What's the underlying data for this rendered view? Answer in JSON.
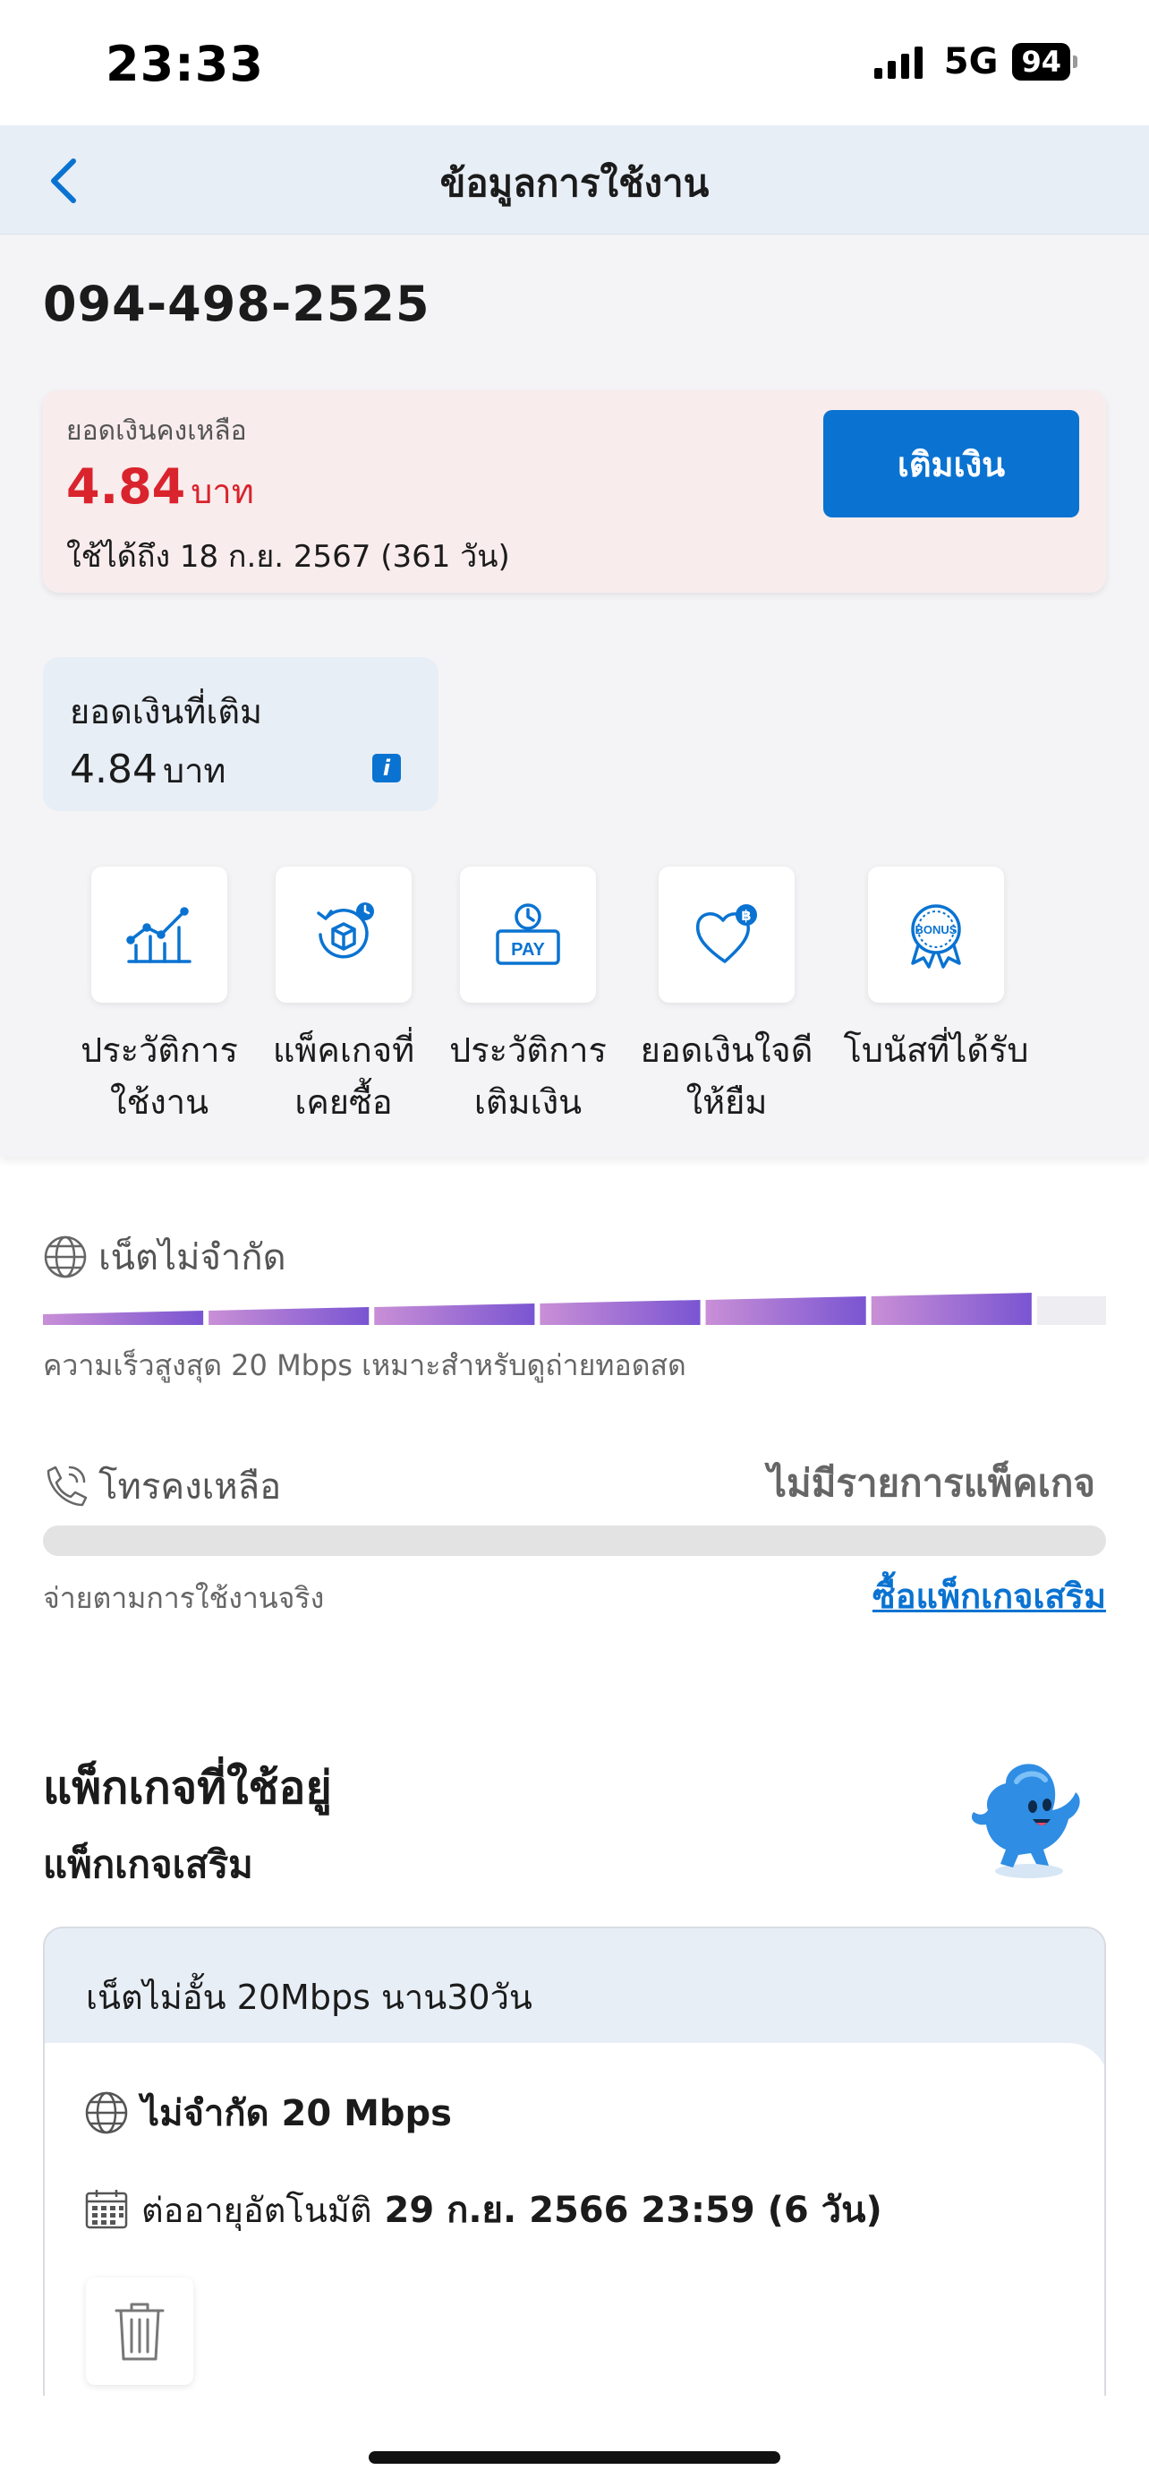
{
  "status_bar": {
    "time": "23:33",
    "network": "5G",
    "battery": "94"
  },
  "nav": {
    "title": "ข้อมูลการใช้งาน"
  },
  "account": {
    "phone_number": "094-498-2525"
  },
  "balance": {
    "label": "ยอดเงินคงเหลือ",
    "amount": "4.84",
    "unit": "บาท",
    "valid_until": "ใช้ได้ถึง 18 ก.ย. 2567 (361 วัน)",
    "topup_label": "เติมเงิน",
    "accent_color": "#d9232d"
  },
  "topup_total": {
    "label": "ยอดเงินที่เติม",
    "amount": "4.84",
    "unit": "บาท",
    "info_icon": "info-icon"
  },
  "shortcuts": [
    {
      "icon": "usage-chart-icon",
      "line1": "ประวัติการ",
      "line2": "ใช้งาน"
    },
    {
      "icon": "package-box-icon",
      "line1": "แพ็คเกจที่",
      "line2": "เคยซื้อ"
    },
    {
      "icon": "pay-history-icon",
      "line1": "ประวัติการ",
      "line2": "เติมเงิน"
    },
    {
      "icon": "heart-coin-icon",
      "line1": "ยอดเงินใจดี",
      "line2": "ให้ยืม"
    },
    {
      "icon": "bonus-badge-icon",
      "line1": "โบนัสที่ได้รับ",
      "line2": ""
    }
  ],
  "internet": {
    "title": "เน็ตไม่จำกัด",
    "description": "ความเร็วสูงสุด 20 Mbps เหมาะสำหรับดูถ่ายทอดสด",
    "speed_level": 0.93
  },
  "voice": {
    "title": "โทรคงเหลือ",
    "status": "ไม่มีรายการแพ็คเกจ",
    "description": "จ่ายตามการใช้งานจริง",
    "buy_link": "ซื้อแพ็กเกจเสริม"
  },
  "packages": {
    "section_title": "แพ็กเกจที่ใช้อยู่",
    "subsection_title": "แพ็กเกจเสริม",
    "card": {
      "name": "เน็ตไม่อั้น 20Mbps นาน30วัน",
      "speed": "ไม่จำกัด 20 Mbps",
      "renew_prefix": "ต่ออายุอัตโนมัติ",
      "renew_date": "29 ก.ย. 2566 23:59 (6 วัน)"
    }
  },
  "colors": {
    "primary": "#0a73d1",
    "speed_gradient_start": "#c98fd6",
    "speed_gradient_end": "#7a55d2"
  }
}
